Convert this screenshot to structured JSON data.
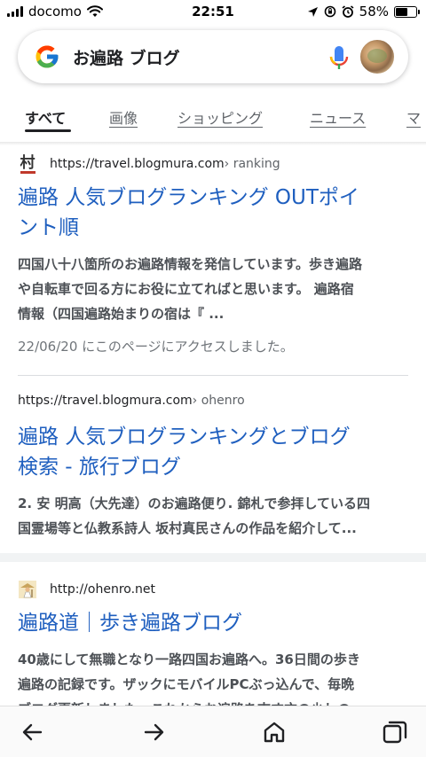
{
  "status_bar": {
    "carrier": "docomo",
    "time": "22:51",
    "battery": "58%",
    "battery_level": 0.58
  },
  "search": {
    "query": "お遍路 ブログ",
    "icons": [
      "google-g-icon",
      "mic-icon",
      "avatar"
    ]
  },
  "tabs": [
    {
      "label": "すべて",
      "active": true
    },
    {
      "label": "画像"
    },
    {
      "label": "ショッピング"
    },
    {
      "label": "ニュース"
    },
    {
      "label": "マ"
    }
  ],
  "results": [
    {
      "favicon_text": "村",
      "url": "https://travel.blogmura.com",
      "breadcrumb": " › ranking",
      "title_line1": "遍路 人気ブログランキング OUTポイ",
      "title_line2": "ント順",
      "snippet_line1": "四国八十八箇所のお遍路情報を発信しています。歩き遍路",
      "snippet_line2": "や自転車で回る方にお役に立てればと思います。 遍路宿",
      "snippet_line3": "情報（四国遍路始まりの宿は『 ...",
      "visited": "22/06/20 にこのページにアクセスしました。"
    },
    {
      "url": "https://travel.blogmura.com",
      "breadcrumb": " › ohenro",
      "title_line1": "遍路 人気ブログランキングとブログ",
      "title_line2": "検索 - 旅行ブログ",
      "snippet_line1": "2. 安 明高（大先達）のお遍路便り. 錦札で参拝している四",
      "snippet_line2": "国霊場等と仏教系詩人 坂村真民さんの作品を紹介して..."
    },
    {
      "url": "http://ohenro.net",
      "title_line1": "遍路道｜歩き遍路ブログ",
      "snippet_line1": "40歳にして無職となり一路四国お遍路へ。36日間の歩き",
      "snippet_line2": "遍路の記録です。ザックにモバイルPCぶっ込んで、毎晩",
      "snippet_line3": "ブログ更新しました。これからお遍路を志す方の少しの"
    }
  ],
  "bottom_nav": [
    "back-arrow-icon",
    "forward-arrow-icon",
    "home-icon",
    "tabs-icon"
  ],
  "colors": {
    "link": "#1f5fbf",
    "text": "#202124",
    "secondary": "#5f6368"
  }
}
